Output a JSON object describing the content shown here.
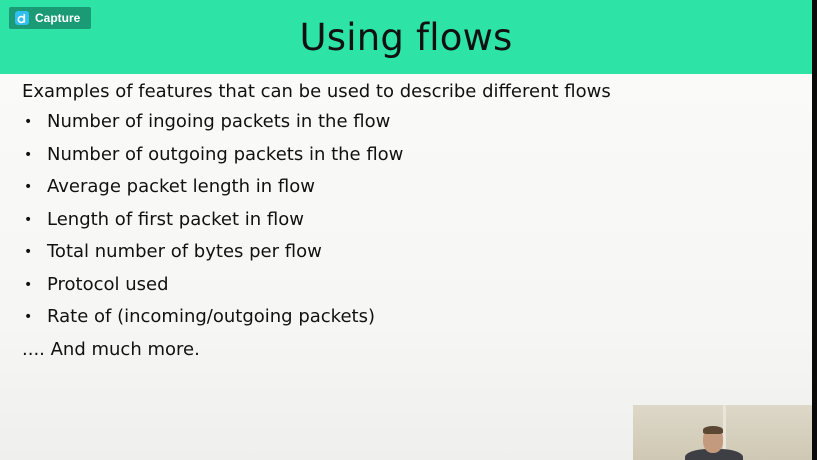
{
  "capture_badge": {
    "label": "Capture",
    "icon": "d-logo-icon"
  },
  "slide": {
    "title": "Using flows",
    "intro": "Examples of features that can be used to describe different flows",
    "bullets": [
      "Number of ingoing packets in the flow",
      "Number of outgoing packets in the flow",
      "Average packet length in flow",
      "Length of first packet in flow",
      "Total number of bytes per flow",
      "Protocol used",
      "Rate of (incoming/outgoing packets)"
    ],
    "bullet_glyph": "•",
    "outro": ".... And much more."
  },
  "colors": {
    "title_bar": "#2de3a5",
    "badge": "#1a9b76",
    "badge_icon": "#2fc0ef",
    "text": "#111111"
  }
}
